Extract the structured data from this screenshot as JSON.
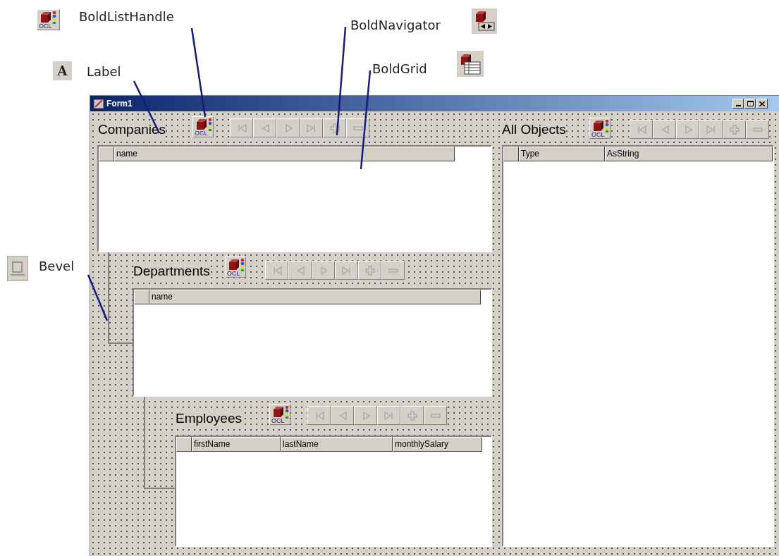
{
  "callouts": [
    {
      "kind": "listhandle",
      "label": "BoldListHandle",
      "icon_text": "OCL"
    },
    {
      "kind": "label",
      "label": "Label",
      "icon_text": "A"
    },
    {
      "kind": "navigator",
      "label": "BoldNavigator"
    },
    {
      "kind": "grid",
      "label": "BoldGrid"
    },
    {
      "kind": "bevel",
      "label": "Bevel"
    }
  ],
  "window": {
    "title": "Form1"
  },
  "panels": [
    {
      "caption": "Companies",
      "handle_text": "OCL",
      "columns": [
        "name"
      ]
    },
    {
      "caption": "Departments",
      "handle_text": "OCL",
      "columns": [
        "name"
      ]
    },
    {
      "caption": "Employees",
      "handle_text": "OCL",
      "columns": [
        "firstName",
        "lastName",
        "monthlySalary"
      ]
    },
    {
      "caption": "All Objects",
      "handle_text": "OCL",
      "columns": [
        "Type",
        "AsString"
      ]
    }
  ]
}
